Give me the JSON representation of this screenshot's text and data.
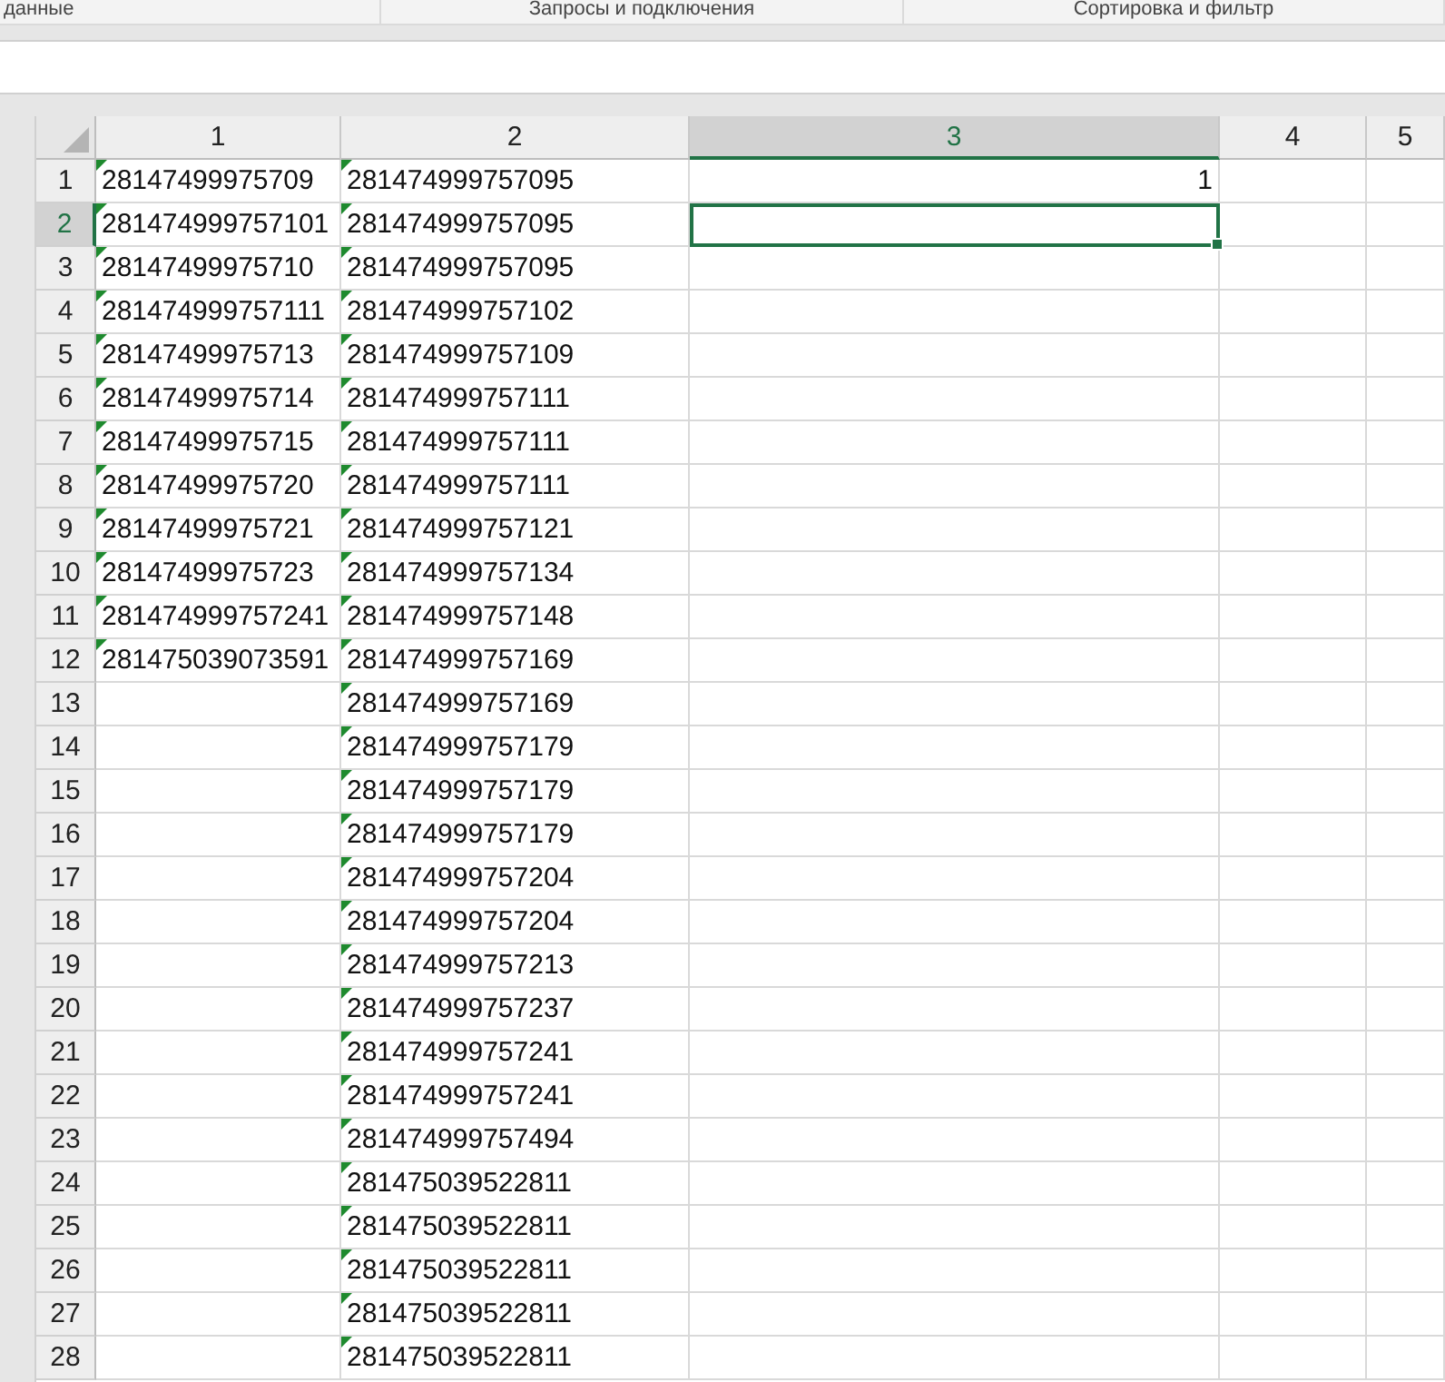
{
  "ribbon_groups": [
    "данные",
    "Запросы и подключения",
    "Сортировка и фильтр"
  ],
  "columns": [
    {
      "label": "1",
      "selected": false
    },
    {
      "label": "2",
      "selected": false
    },
    {
      "label": "3",
      "selected": true
    },
    {
      "label": "4",
      "selected": false
    },
    {
      "label": "5",
      "selected": false
    }
  ],
  "rows": [
    {
      "label": "1",
      "selected": false,
      "cells": [
        {
          "value": "28147499975709",
          "flagged": true,
          "selected": false
        },
        {
          "value": "281474999757095",
          "flagged": true,
          "selected": false
        },
        {
          "value": "1",
          "flagged": false,
          "selected": false
        }
      ]
    },
    {
      "label": "2",
      "selected": true,
      "cells": [
        {
          "value": "281474999757101",
          "flagged": true,
          "selected": false
        },
        {
          "value": "281474999757095",
          "flagged": true,
          "selected": false
        },
        {
          "flagged": false,
          "selected": true
        }
      ]
    },
    {
      "label": "3",
      "selected": false,
      "cells": [
        {
          "value": "28147499975710",
          "flagged": true,
          "selected": false
        },
        {
          "value": "281474999757095",
          "flagged": true,
          "selected": false
        },
        {
          "flagged": false,
          "selected": false
        }
      ]
    },
    {
      "label": "4",
      "selected": false,
      "cells": [
        {
          "value": "281474999757111",
          "flagged": true,
          "selected": false
        },
        {
          "value": "281474999757102",
          "flagged": true,
          "selected": false
        },
        {
          "flagged": false,
          "selected": false
        }
      ]
    },
    {
      "label": "5",
      "selected": false,
      "cells": [
        {
          "value": "28147499975713",
          "flagged": true,
          "selected": false
        },
        {
          "value": "281474999757109",
          "flagged": true,
          "selected": false
        },
        {
          "flagged": false,
          "selected": false
        }
      ]
    },
    {
      "label": "6",
      "selected": false,
      "cells": [
        {
          "value": "28147499975714",
          "flagged": true,
          "selected": false
        },
        {
          "value": "281474999757111",
          "flagged": true,
          "selected": false
        },
        {
          "flagged": false,
          "selected": false
        }
      ]
    },
    {
      "label": "7",
      "selected": false,
      "cells": [
        {
          "value": "28147499975715",
          "flagged": true,
          "selected": false
        },
        {
          "value": "281474999757111",
          "flagged": true,
          "selected": false
        },
        {
          "flagged": false,
          "selected": false
        }
      ]
    },
    {
      "label": "8",
      "selected": false,
      "cells": [
        {
          "value": "28147499975720",
          "flagged": true,
          "selected": false
        },
        {
          "value": "281474999757111",
          "flagged": true,
          "selected": false
        },
        {
          "flagged": false,
          "selected": false
        }
      ]
    },
    {
      "label": "9",
      "selected": false,
      "cells": [
        {
          "value": "28147499975721",
          "flagged": true,
          "selected": false
        },
        {
          "value": "281474999757121",
          "flagged": true,
          "selected": false
        },
        {
          "flagged": false,
          "selected": false
        }
      ]
    },
    {
      "label": "10",
      "selected": false,
      "cells": [
        {
          "value": "28147499975723",
          "flagged": true,
          "selected": false
        },
        {
          "value": "281474999757134",
          "flagged": true,
          "selected": false
        },
        {
          "flagged": false,
          "selected": false
        }
      ]
    },
    {
      "label": "11",
      "selected": false,
      "cells": [
        {
          "value": "281474999757241",
          "flagged": true,
          "selected": false
        },
        {
          "value": "281474999757148",
          "flagged": true,
          "selected": false
        },
        {
          "flagged": false,
          "selected": false
        }
      ]
    },
    {
      "label": "12",
      "selected": false,
      "cells": [
        {
          "value": "281475039073591",
          "flagged": true,
          "selected": false
        },
        {
          "value": "281474999757169",
          "flagged": true,
          "selected": false
        },
        {
          "flagged": false,
          "selected": false
        }
      ]
    },
    {
      "label": "13",
      "selected": false,
      "cells": [
        {
          "flagged": false,
          "selected": false
        },
        {
          "value": "281474999757169",
          "flagged": true,
          "selected": false
        },
        {
          "flagged": false,
          "selected": false
        }
      ]
    },
    {
      "label": "14",
      "selected": false,
      "cells": [
        {
          "flagged": false,
          "selected": false
        },
        {
          "value": "281474999757179",
          "flagged": true,
          "selected": false
        },
        {
          "flagged": false,
          "selected": false
        }
      ]
    },
    {
      "label": "15",
      "selected": false,
      "cells": [
        {
          "flagged": false,
          "selected": false
        },
        {
          "value": "281474999757179",
          "flagged": true,
          "selected": false
        },
        {
          "flagged": false,
          "selected": false
        }
      ]
    },
    {
      "label": "16",
      "selected": false,
      "cells": [
        {
          "flagged": false,
          "selected": false
        },
        {
          "value": "281474999757179",
          "flagged": true,
          "selected": false
        },
        {
          "flagged": false,
          "selected": false
        }
      ]
    },
    {
      "label": "17",
      "selected": false,
      "cells": [
        {
          "flagged": false,
          "selected": false
        },
        {
          "value": "281474999757204",
          "flagged": true,
          "selected": false
        },
        {
          "flagged": false,
          "selected": false
        }
      ]
    },
    {
      "label": "18",
      "selected": false,
      "cells": [
        {
          "flagged": false,
          "selected": false
        },
        {
          "value": "281474999757204",
          "flagged": true,
          "selected": false
        },
        {
          "flagged": false,
          "selected": false
        }
      ]
    },
    {
      "label": "19",
      "selected": false,
      "cells": [
        {
          "flagged": false,
          "selected": false
        },
        {
          "value": "281474999757213",
          "flagged": true,
          "selected": false
        },
        {
          "flagged": false,
          "selected": false
        }
      ]
    },
    {
      "label": "20",
      "selected": false,
      "cells": [
        {
          "flagged": false,
          "selected": false
        },
        {
          "value": "281474999757237",
          "flagged": true,
          "selected": false
        },
        {
          "flagged": false,
          "selected": false
        }
      ]
    },
    {
      "label": "21",
      "selected": false,
      "cells": [
        {
          "flagged": false,
          "selected": false
        },
        {
          "value": "281474999757241",
          "flagged": true,
          "selected": false
        },
        {
          "flagged": false,
          "selected": false
        }
      ]
    },
    {
      "label": "22",
      "selected": false,
      "cells": [
        {
          "flagged": false,
          "selected": false
        },
        {
          "value": "281474999757241",
          "flagged": true,
          "selected": false
        },
        {
          "flagged": false,
          "selected": false
        }
      ]
    },
    {
      "label": "23",
      "selected": false,
      "cells": [
        {
          "flagged": false,
          "selected": false
        },
        {
          "value": "281474999757494",
          "flagged": true,
          "selected": false
        },
        {
          "flagged": false,
          "selected": false
        }
      ]
    },
    {
      "label": "24",
      "selected": false,
      "cells": [
        {
          "flagged": false,
          "selected": false
        },
        {
          "value": "281475039522811",
          "flagged": true,
          "selected": false
        },
        {
          "flagged": false,
          "selected": false
        }
      ]
    },
    {
      "label": "25",
      "selected": false,
      "cells": [
        {
          "flagged": false,
          "selected": false
        },
        {
          "value": "281475039522811",
          "flagged": true,
          "selected": false
        },
        {
          "flagged": false,
          "selected": false
        }
      ]
    },
    {
      "label": "26",
      "selected": false,
      "cells": [
        {
          "flagged": false,
          "selected": false
        },
        {
          "value": "281475039522811",
          "flagged": true,
          "selected": false
        },
        {
          "flagged": false,
          "selected": false
        }
      ]
    },
    {
      "label": "27",
      "selected": false,
      "cells": [
        {
          "flagged": false,
          "selected": false
        },
        {
          "value": "281475039522811",
          "flagged": true,
          "selected": false
        },
        {
          "flagged": false,
          "selected": false
        }
      ]
    },
    {
      "label": "28",
      "selected": false,
      "cells": [
        {
          "flagged": false,
          "selected": false
        },
        {
          "value": "281475039522811",
          "flagged": true,
          "selected": false
        },
        {
          "flagged": false,
          "selected": false
        }
      ]
    }
  ]
}
